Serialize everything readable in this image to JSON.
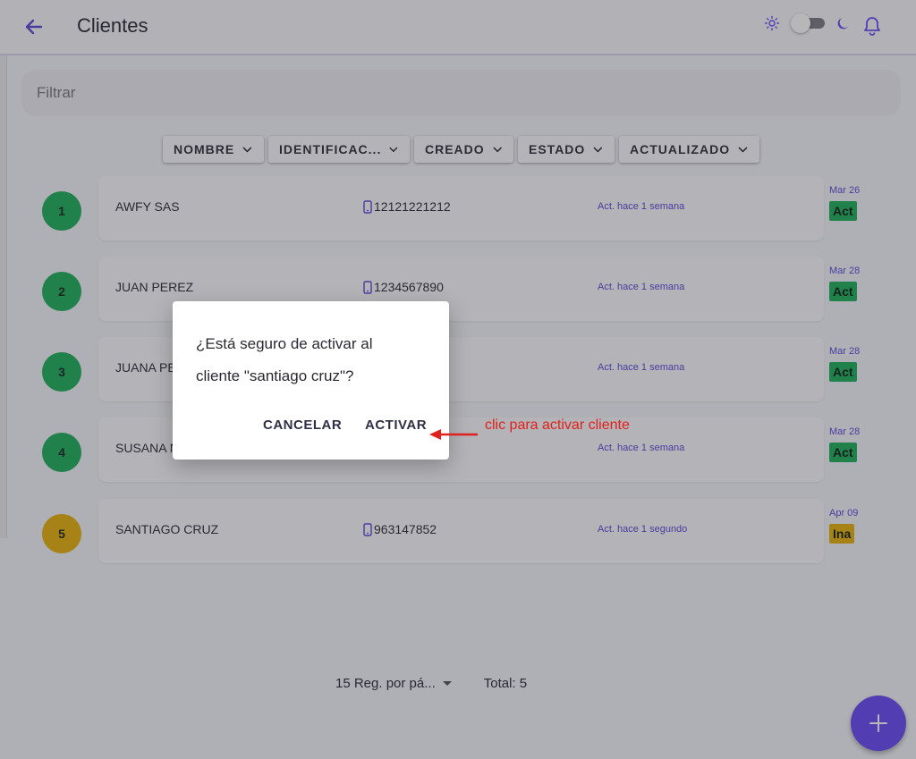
{
  "header": {
    "title": "Clientes"
  },
  "filter": {
    "placeholder": "Filtrar"
  },
  "sort_buttons": [
    {
      "label": "NOMBRE"
    },
    {
      "label": "IDENTIFICAC..."
    },
    {
      "label": "CREADO"
    },
    {
      "label": "ESTADO"
    },
    {
      "label": "ACTUALIZADO"
    }
  ],
  "clients": [
    {
      "num": "1",
      "name": "AWFY SAS",
      "id": "12121221212",
      "updated": "Act. hace 1 semana",
      "date": "Mar 26",
      "status": "Act"
    },
    {
      "num": "2",
      "name": "JUAN PEREZ",
      "id": "1234567890",
      "updated": "Act. hace 1 semana",
      "date": "Mar 28",
      "status": "Act"
    },
    {
      "num": "3",
      "name": "JUANA PE",
      "id": "",
      "updated": "Act. hace 1 semana",
      "date": "Mar 28",
      "status": "Act"
    },
    {
      "num": "4",
      "name": "SUSANA N",
      "id": "",
      "updated": "Act. hace 1 semana",
      "date": "Mar 28",
      "status": "Act"
    },
    {
      "num": "5",
      "name": "SANTIAGO CRUZ",
      "id": "963147852",
      "updated": "Act. hace 1 segundo",
      "date": "Apr 09",
      "status": "Ina"
    }
  ],
  "pagination": {
    "per_page": "15 Reg. por pá...",
    "total": "Total: 5"
  },
  "dialog": {
    "line1": "¿Está seguro de activar al",
    "line2": "cliente \"santiago cruz\"?",
    "cancel": "CANCELAR",
    "confirm": "ACTIVAR"
  },
  "annotation": {
    "text": "clic para activar cliente"
  },
  "colors": {
    "accent": "#6a4df4",
    "active_badge": "#22b05a",
    "inactive_badge": "#e8b10e",
    "annotation": "#e0201b"
  },
  "icons": [
    "back-arrow-icon",
    "sun-icon",
    "moon-icon",
    "bell-icon",
    "chevron-down-icon",
    "phone-icon",
    "plus-icon",
    "red-arrow-icon"
  ]
}
